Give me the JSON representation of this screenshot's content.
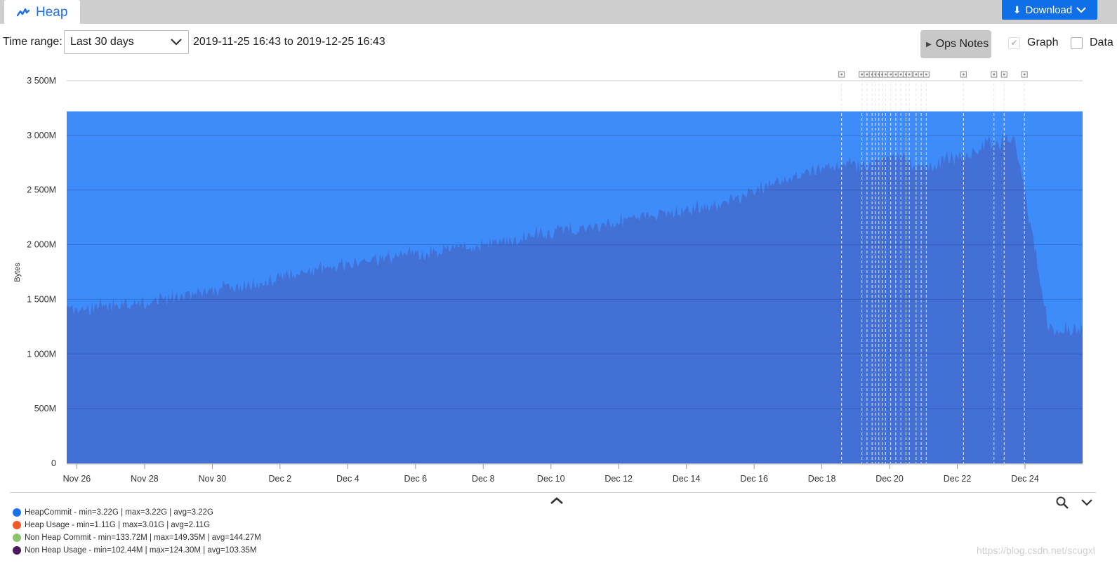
{
  "tab": {
    "title": "Heap",
    "icon": "activity-icon"
  },
  "download": {
    "label": "Download",
    "icon": "download-arrow-icon"
  },
  "time_range": {
    "label": "Time range:",
    "selected": "Last 30 days",
    "range_text": "2019-11-25 16:43 to 2019-12-25 16:43"
  },
  "ops_notes": {
    "label": "Ops Notes"
  },
  "toggles": {
    "graph_label": "Graph",
    "graph_checked": true,
    "data_label": "Data",
    "data_checked": false
  },
  "colors": {
    "heap_commit": "#3e8cf9",
    "heap_usage": "#4270d5",
    "accent": "#0f6fe8"
  },
  "chart_data": {
    "type": "area",
    "ylabel": "Bytes",
    "ylim": [
      0,
      3500
    ],
    "yticks": [
      "0",
      "500M",
      "1 000M",
      "1 500M",
      "2 000M",
      "2 500M",
      "3 000M",
      "3 500M"
    ],
    "xticks": [
      "Nov 26",
      "Nov 28",
      "Nov 30",
      "Dec 2",
      "Dec 4",
      "Dec 6",
      "Dec 8",
      "Dec 10",
      "Dec 12",
      "Dec 14",
      "Dec 16",
      "Dec 18",
      "Dec 20",
      "Dec 22",
      "Dec 24"
    ],
    "x_days": [
      0,
      30
    ],
    "series": [
      {
        "name": "HeapCommit",
        "color": "#3e8cf9",
        "x": [
          0,
          30
        ],
        "values": [
          3220,
          3220
        ]
      },
      {
        "name": "Heap Usage",
        "color": "#4270d5",
        "x": [
          0,
          2,
          4,
          6,
          8,
          10,
          12,
          14,
          16,
          18,
          19.5,
          20.3,
          21,
          22,
          23.2,
          23.4,
          24,
          24.8,
          25,
          25.6,
          26,
          26.2,
          26.8,
          27,
          28,
          29,
          30
        ],
        "values": [
          1450,
          1500,
          1600,
          1720,
          1850,
          1950,
          2020,
          2130,
          2240,
          2350,
          2420,
          2540,
          2620,
          2730,
          2780,
          2770,
          2810,
          2860,
          2760,
          2770,
          2830,
          2820,
          2900,
          2950,
          3010,
          1300,
          1310
        ]
      }
    ],
    "ops_notes_days": [
      22.8,
      23.4,
      23.55,
      23.7,
      23.8,
      23.9,
      24.0,
      24.1,
      24.25,
      24.4,
      24.55,
      24.7,
      24.8,
      25.0,
      25.15,
      25.3,
      26.4,
      27.3,
      27.6,
      28.2
    ]
  },
  "legend": [
    {
      "label": "HeapCommit - min=3.22G | max=3.22G | avg=3.22G",
      "color": "#1a73e8"
    },
    {
      "label": "Heap Usage - min=1.11G | max=3.01G | avg=2.11G",
      "color": "#f15a24"
    },
    {
      "label": "Non Heap Commit - min=133.72M | max=149.35M | avg=144.27M",
      "color": "#8dc26f"
    },
    {
      "label": "Non Heap Usage - min=102.44M | max=124.30M | avg=103.35M",
      "color": "#4b1a5e"
    }
  ],
  "watermark": "https://blog.csdn.net/scugxl"
}
